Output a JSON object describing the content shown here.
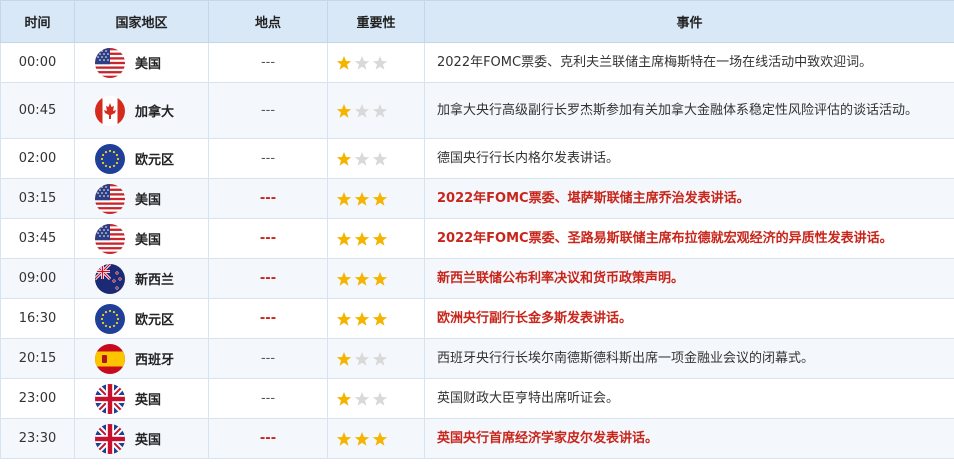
{
  "headers": {
    "time": "时间",
    "country": "国家地区",
    "location": "地点",
    "importance": "重要性",
    "event": "事件"
  },
  "colors": {
    "high": "#c8251b",
    "star_on": "#f5b400",
    "star_off": "#d9d9d9",
    "header_bg": "#d9e8f7"
  },
  "rows": [
    {
      "time": "00:00",
      "country": "美国",
      "flag": "us-flag-icon",
      "location": "---",
      "stars": 1,
      "event": "2022年FOMC票委、克利夫兰联储主席梅斯特在一场在线活动中致欢迎词。"
    },
    {
      "time": "00:45",
      "country": "加拿大",
      "flag": "ca-flag-icon",
      "location": "---",
      "stars": 1,
      "event": "加拿大央行高级副行长罗杰斯参加有关加拿大金融体系稳定性风险评估的谈话活动。"
    },
    {
      "time": "02:00",
      "country": "欧元区",
      "flag": "eu-flag-icon",
      "location": "---",
      "stars": 1,
      "event": "德国央行行长内格尔发表讲话。"
    },
    {
      "time": "03:15",
      "country": "美国",
      "flag": "us-flag-icon",
      "location": "---",
      "stars": 3,
      "event": "2022年FOMC票委、堪萨斯联储主席乔治发表讲话。"
    },
    {
      "time": "03:45",
      "country": "美国",
      "flag": "us-flag-icon",
      "location": "---",
      "stars": 3,
      "event": "2022年FOMC票委、圣路易斯联储主席布拉德就宏观经济的异质性发表讲话。"
    },
    {
      "time": "09:00",
      "country": "新西兰",
      "flag": "nz-flag-icon",
      "location": "---",
      "stars": 3,
      "event": "新西兰联储公布利率决议和货币政策声明。"
    },
    {
      "time": "16:30",
      "country": "欧元区",
      "flag": "eu-flag-icon",
      "location": "---",
      "stars": 3,
      "event": "欧洲央行副行长金多斯发表讲话。"
    },
    {
      "time": "20:15",
      "country": "西班牙",
      "flag": "es-flag-icon",
      "location": "---",
      "stars": 1,
      "event": "西班牙央行行长埃尔南德斯德科斯出席一项金融业会议的闭幕式。"
    },
    {
      "time": "23:00",
      "country": "英国",
      "flag": "uk-flag-icon",
      "location": "---",
      "stars": 1,
      "event": "英国财政大臣亨特出席听证会。"
    },
    {
      "time": "23:30",
      "country": "英国",
      "flag": "uk-flag-icon",
      "location": "---",
      "stars": 3,
      "event": "英国央行首席经济学家皮尔发表讲话。"
    }
  ]
}
